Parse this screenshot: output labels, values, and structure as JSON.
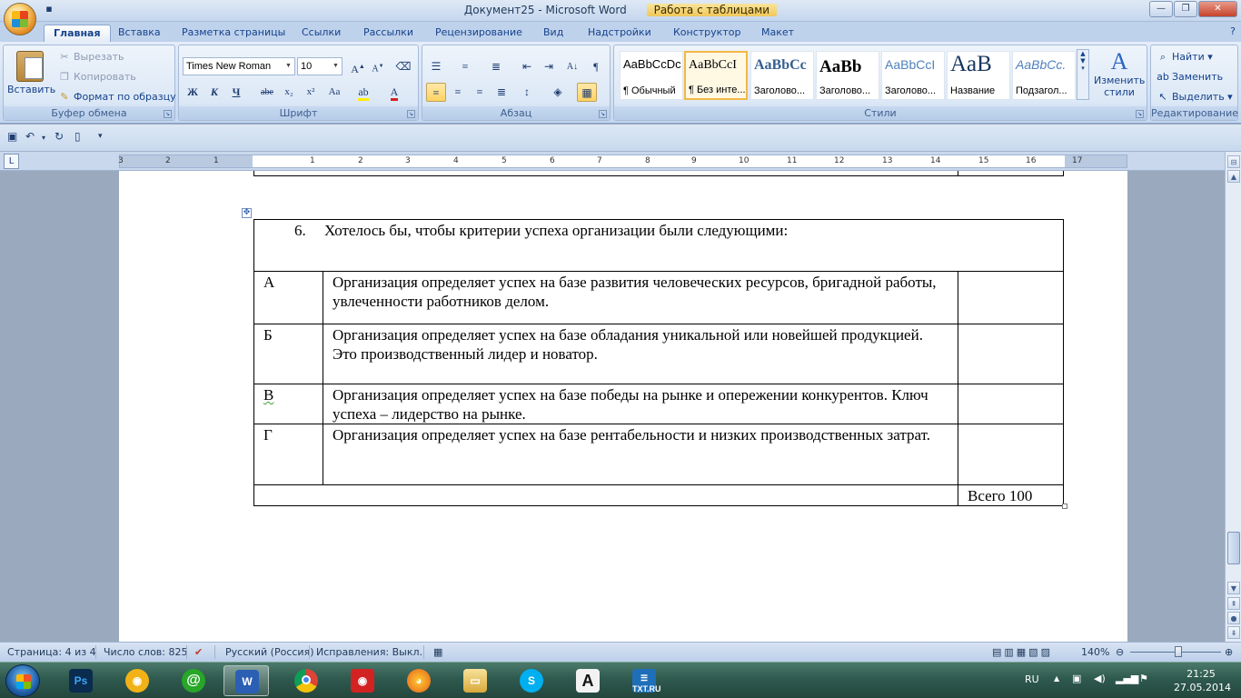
{
  "titlebar": {
    "title": "Документ25 - Microsoft Word",
    "context_tab": "Работа с таблицами"
  },
  "tabs": [
    "Главная",
    "Вставка",
    "Разметка страницы",
    "Ссылки",
    "Рассылки",
    "Рецензирование",
    "Вид",
    "Надстройки",
    "Конструктор",
    "Макет"
  ],
  "ribbon": {
    "clipboard": {
      "paste": "Вставить",
      "cut": "Вырезать",
      "copy": "Копировать",
      "format_painter": "Формат по образцу",
      "label": "Буфер обмена"
    },
    "font": {
      "name": "Times New Roman",
      "size": "10",
      "label": "Шрифт"
    },
    "paragraph": {
      "label": "Абзац"
    },
    "styles": {
      "label": "Стили",
      "items": [
        {
          "sample": "AaBbCcDc",
          "name": "¶ Обычный"
        },
        {
          "sample": "AaBbCcI",
          "name": "¶ Без инте..."
        },
        {
          "sample": "AaBbCc",
          "name": "Заголово..."
        },
        {
          "sample": "AaBb",
          "name": "Заголово..."
        },
        {
          "sample": "AaBbCcI",
          "name": "Заголово..."
        },
        {
          "sample": "AaB",
          "name": "Название"
        },
        {
          "sample": "AaBbCc.",
          "name": "Подзагол..."
        }
      ],
      "change_styles": "Изменить стили"
    },
    "editing": {
      "label": "Редактирование",
      "find": "Найти",
      "replace": "Заменить",
      "select": "Выделить"
    }
  },
  "ruler_numbers": [
    "3",
    "2",
    "1",
    "1",
    "2",
    "3",
    "4",
    "5",
    "6",
    "7",
    "8",
    "9",
    "10",
    "11",
    "12",
    "13",
    "14",
    "15",
    "16",
    "17"
  ],
  "document": {
    "heading_number": "6.",
    "heading_text": "Хотелось бы, чтобы критерии успеха организации были следующими:",
    "rows": [
      {
        "letter": "А",
        "text": "Организация определяет успех на базе развития человеческих ресурсов, бригадной работы, увлеченности работников делом."
      },
      {
        "letter": "Б",
        "text": "Организация определяет успех на базе обладания уникальной или новейшей продукцией. Это производственный лидер и новатор."
      },
      {
        "letter": "В",
        "text": "Организация определяет успех на базе победы на рынке и опережении конкурентов. Ключ успеха – лидерство на рынке."
      },
      {
        "letter": "Г",
        "text": "Организация определяет успех на базе рентабельности и низких производственных затрат."
      }
    ],
    "total": "Всего 100"
  },
  "statusbar": {
    "page": "Страница: 4 из 4",
    "words": "Число слов: 825",
    "language": "Русский (Россия)",
    "track_changes": "Исправления: Выкл.",
    "zoom": "140%"
  },
  "taskbar": {
    "lang": "RU",
    "time": "21:25",
    "date": "27.05.2014",
    "apps": [
      "Photoshop",
      "Agent",
      "Mail.ru",
      "Word",
      "Chrome",
      "Recorder",
      "Firefox",
      "Explorer",
      "Skype",
      "Font",
      "TXT.RU"
    ],
    "txt_label": "TXT.RU"
  },
  "colors": {
    "ribbon_text": "#15428b",
    "taskbar": "#2f5a4f",
    "active_style_border": "#f2b845"
  }
}
